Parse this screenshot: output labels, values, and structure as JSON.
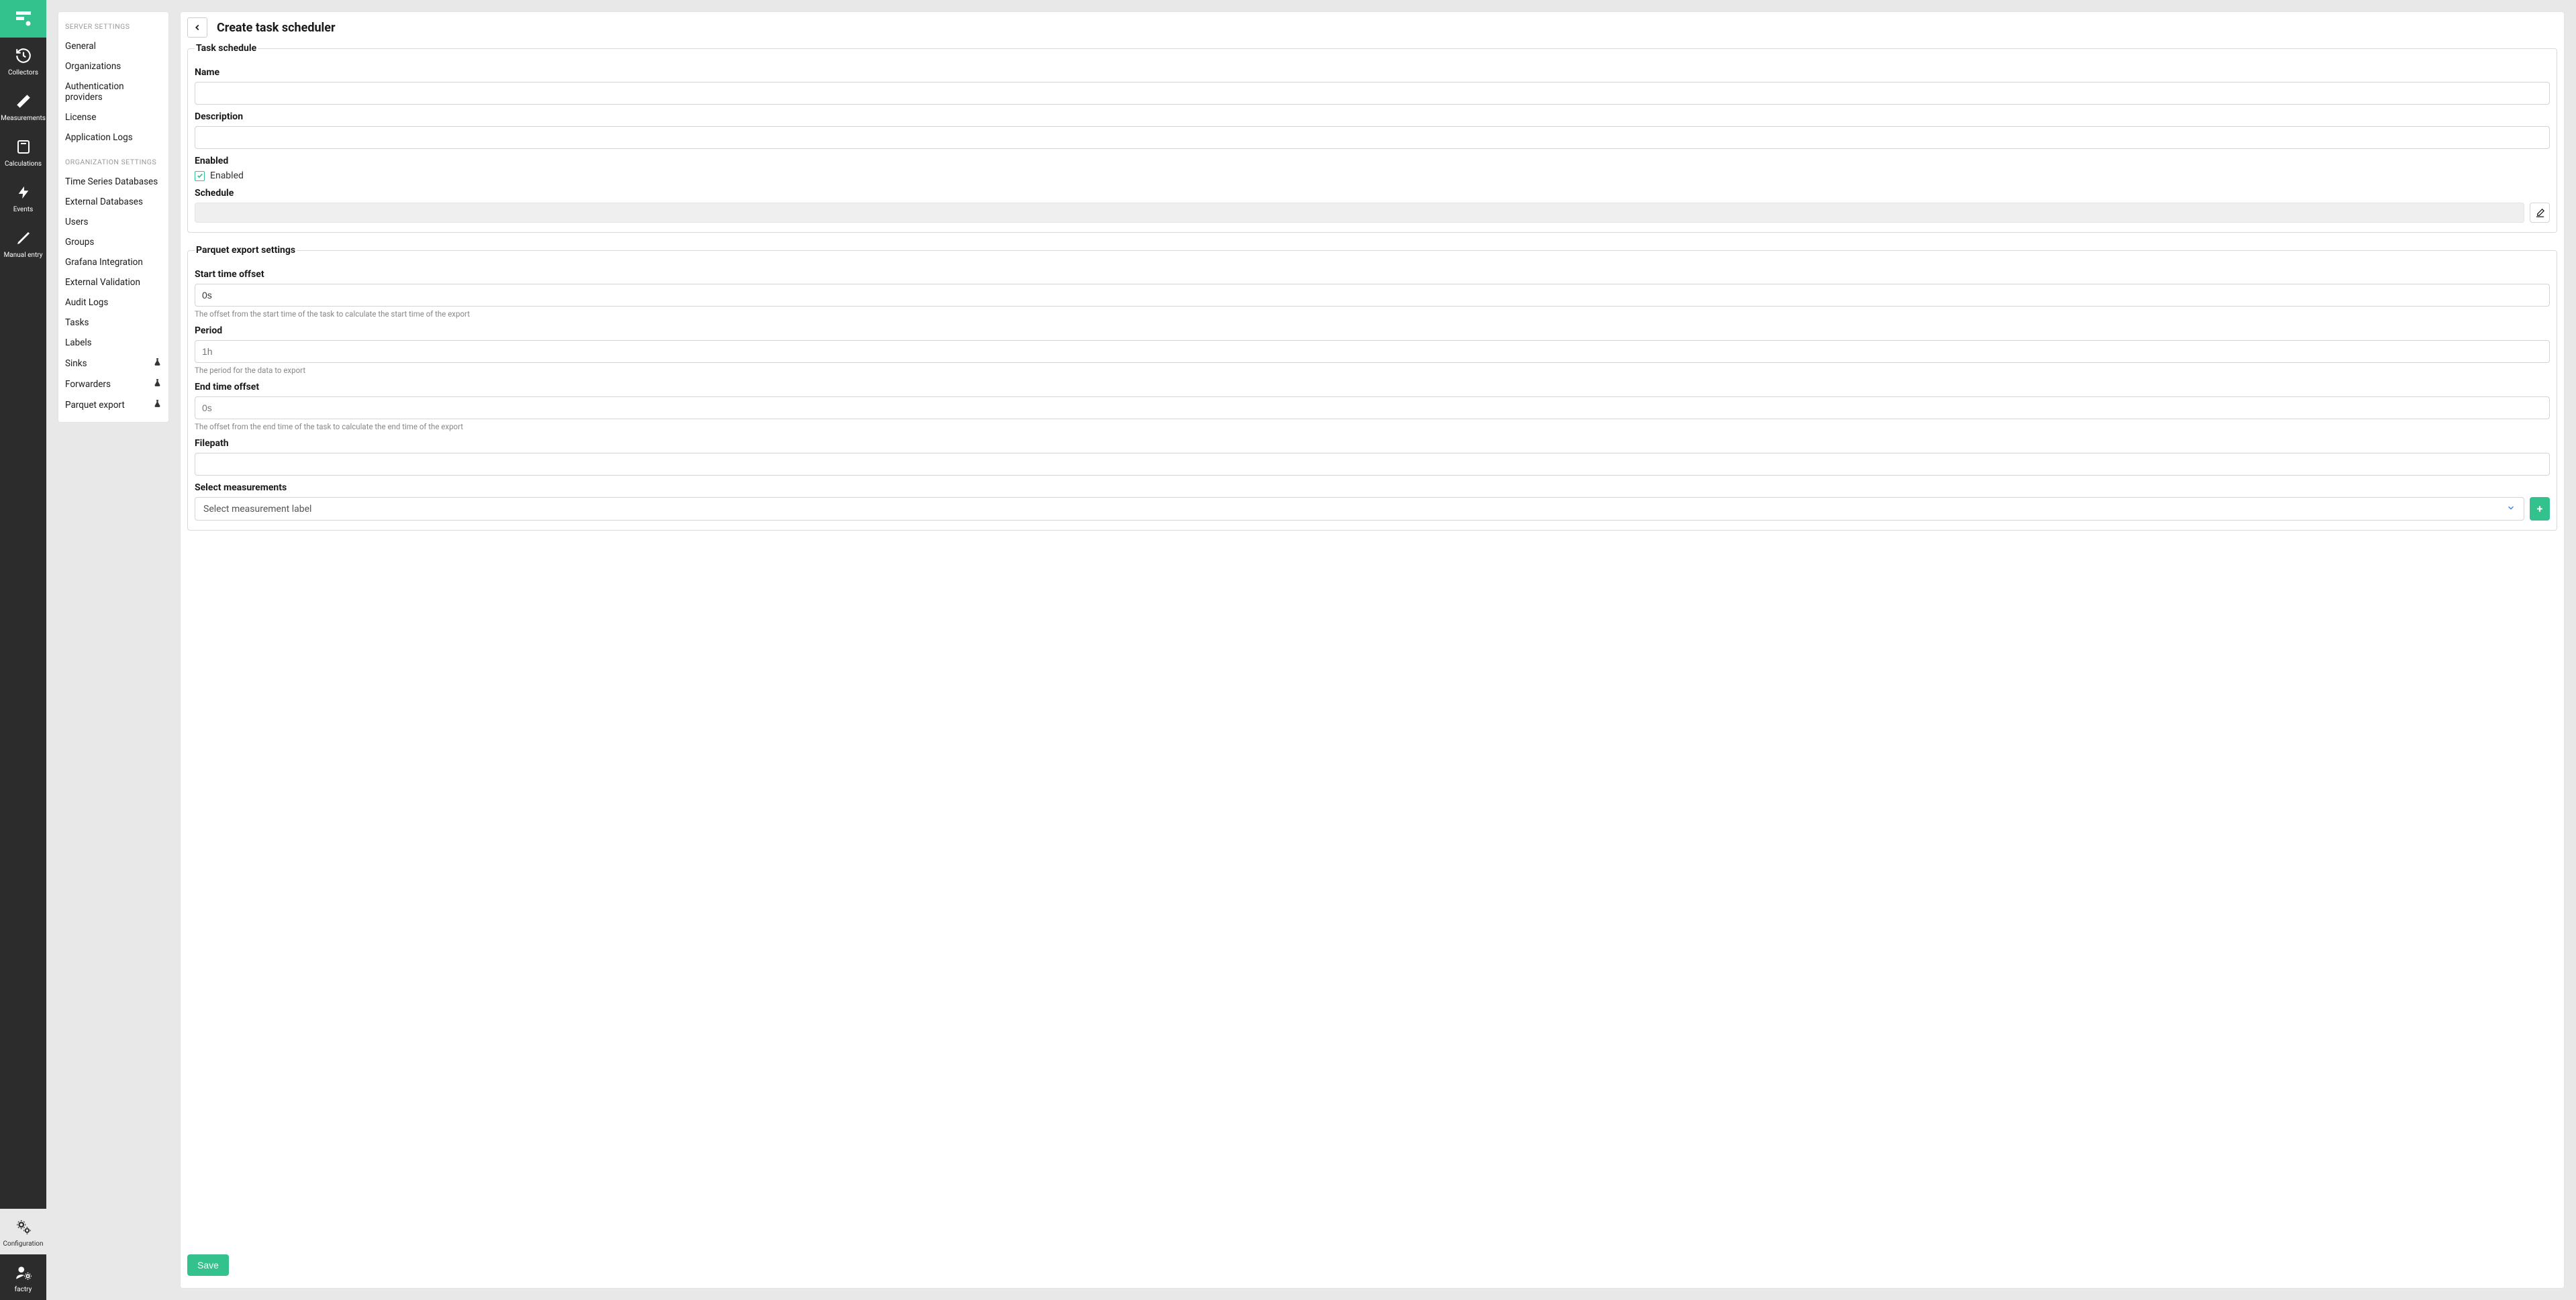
{
  "nav": {
    "items": [
      {
        "label": "Collectors"
      },
      {
        "label": "Measurements"
      },
      {
        "label": "Calculations"
      },
      {
        "label": "Events"
      },
      {
        "label": "Manual entry"
      }
    ],
    "bottom": [
      {
        "label": "Configuration"
      },
      {
        "label": "factry"
      }
    ]
  },
  "sidebar": {
    "serverHeader": "SERVER SETTINGS",
    "serverItems": [
      {
        "label": "General"
      },
      {
        "label": "Organizations"
      },
      {
        "label": "Authentication providers"
      },
      {
        "label": "License"
      },
      {
        "label": "Application Logs"
      }
    ],
    "orgHeader": "ORGANIZATION SETTINGS",
    "orgItems": [
      {
        "label": "Time Series Databases"
      },
      {
        "label": "External Databases"
      },
      {
        "label": "Users"
      },
      {
        "label": "Groups"
      },
      {
        "label": "Grafana Integration"
      },
      {
        "label": "External Validation"
      },
      {
        "label": "Audit Logs"
      },
      {
        "label": "Tasks"
      },
      {
        "label": "Labels"
      },
      {
        "label": "Sinks",
        "beta": true
      },
      {
        "label": "Forwarders",
        "beta": true
      },
      {
        "label": "Parquet export",
        "beta": true
      }
    ]
  },
  "page": {
    "title": "Create task scheduler",
    "saveLabel": "Save"
  },
  "taskSchedule": {
    "legend": "Task schedule",
    "nameLabel": "Name",
    "nameValue": "",
    "descriptionLabel": "Description",
    "descriptionValue": "",
    "enabledLabel": "Enabled",
    "enabledCheckboxLabel": "Enabled",
    "enabledValue": true,
    "scheduleLabel": "Schedule",
    "scheduleValue": ""
  },
  "parquet": {
    "legend": "Parquet export settings",
    "startOffsetLabel": "Start time offset",
    "startOffsetValue": "0s",
    "startOffsetHelp": "The offset from the start time of the task to calculate the start time of the export",
    "periodLabel": "Period",
    "periodPlaceholder": "1h",
    "periodValue": "",
    "periodHelp": "The period for the data to export",
    "endOffsetLabel": "End time offset",
    "endOffsetPlaceholder": "0s",
    "endOffsetValue": "",
    "endOffsetHelp": "The offset from the end time of the task to calculate the end time of the export",
    "filepathLabel": "Filepath",
    "filepathValue": "",
    "selectMeasurementsLabel": "Select measurements",
    "selectPlaceholder": "Select measurement label"
  }
}
